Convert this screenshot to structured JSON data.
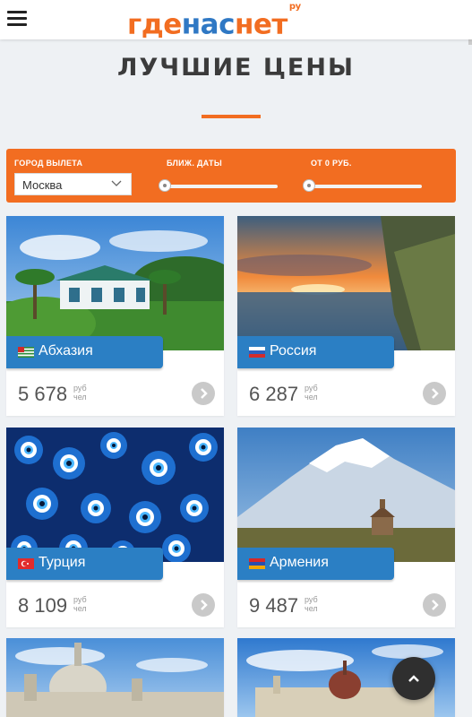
{
  "header": {
    "logo_part1": "где",
    "logo_part2": "нас",
    "logo_part3": "нет",
    "logo_suffix": "ру"
  },
  "page_title": "ЛУЧШИЕ ЦЕНЫ",
  "filters": {
    "city_label": "Город вылета",
    "city_value": "Москва",
    "dates_label": "Ближ. даты",
    "price_label": "от 0 руб."
  },
  "price_unit_top": "руб",
  "price_unit_bottom": "чел",
  "cards": [
    {
      "name": "Абхазия",
      "price": "5 678"
    },
    {
      "name": "Россия",
      "price": "6 287"
    },
    {
      "name": "Турция",
      "price": "8 109"
    },
    {
      "name": "Армения",
      "price": "9 487"
    }
  ],
  "colors": {
    "brand_orange": "#f26d21",
    "brand_blue": "#2b7fc4"
  },
  "icons": {
    "menu": "hamburger-icon",
    "dropdown": "chevron-down-icon",
    "card_action": "chevron-right-icon",
    "scroll_top": "chevron-up-icon"
  }
}
